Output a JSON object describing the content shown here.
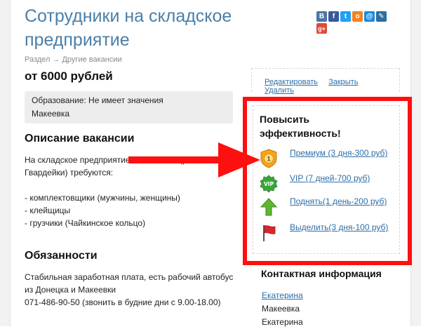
{
  "page": {
    "title": "Сотрудники на складское предприятие",
    "breadcrumb_section": "Раздел",
    "breadcrumb_arrow": "→",
    "breadcrumb_category": "Другие вакансии",
    "salary": "от 6000 рублей"
  },
  "info": {
    "education": "Образование: Не имеет значения",
    "city": "Макеевка"
  },
  "description": {
    "heading": "Описание вакансии",
    "intro_line1": "На складское предприятие в Макеевке (р-н",
    "intro_line2": "Гвардейки) требуются:",
    "items": [
      "- комплектовщики (мужчины, женщины)",
      "- клейщицы",
      "- грузчики (Чайкинское кольцо)"
    ]
  },
  "duties": {
    "heading": "Обязанности",
    "line1": "Стабильная заработная плата, есть рабочий автобус",
    "line2": "из Донецка и Макеевки",
    "line3": "071-486-90-50 (звонить в будние дни с 9.00-18.00)"
  },
  "actions": {
    "edit": "Редактировать",
    "close": "Закрыть",
    "delete": "Удалить"
  },
  "promo": {
    "title": "Повысить эффективность!",
    "options": [
      {
        "label": "Премиум (3 дня-300 руб)",
        "icon": "premium-badge-icon",
        "badge_text": "1"
      },
      {
        "label": "VIP (7 дней-700 руб)",
        "icon": "vip-badge-icon",
        "badge_text": "VIP"
      },
      {
        "label": "Поднять(1 день-200 руб)",
        "icon": "arrow-up-icon"
      },
      {
        "label": "Выделить(3 дня-100 руб)",
        "icon": "flag-icon"
      }
    ]
  },
  "contacts": {
    "heading": "Контактная информация",
    "name_link": "Екатерина",
    "city": "Макеевка",
    "name": "Екатерина"
  },
  "social": {
    "icons": [
      {
        "name": "vk-icon",
        "glyph": "B",
        "color": "#4c75a3"
      },
      {
        "name": "facebook-icon",
        "glyph": "f",
        "color": "#3b5998"
      },
      {
        "name": "twitter-icon",
        "glyph": "t",
        "color": "#1da1f2"
      },
      {
        "name": "odnoklassniki-icon",
        "glyph": "о",
        "color": "#f58220"
      },
      {
        "name": "mail-ru-icon",
        "glyph": "@",
        "color": "#168de2"
      },
      {
        "name": "livejournal-icon",
        "glyph": "✎",
        "color": "#2d6fa0"
      },
      {
        "name": "google-plus-icon",
        "glyph": "g+",
        "color": "#dd4b39"
      }
    ]
  },
  "colors": {
    "link": "#2e6ea6",
    "title": "#4a7fa8",
    "highlight": "#ff0f0f"
  }
}
